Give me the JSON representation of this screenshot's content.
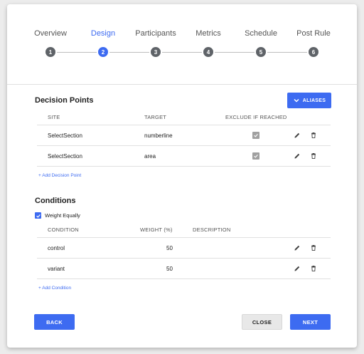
{
  "stepper": {
    "steps": [
      {
        "label": "Overview",
        "number": "1",
        "active": false
      },
      {
        "label": "Design",
        "number": "2",
        "active": true
      },
      {
        "label": "Participants",
        "number": "3",
        "active": false
      },
      {
        "label": "Metrics",
        "number": "4",
        "active": false
      },
      {
        "label": "Schedule",
        "number": "5",
        "active": false
      },
      {
        "label": "Post Rule",
        "number": "6",
        "active": false
      }
    ]
  },
  "decision_points": {
    "title": "Decision Points",
    "aliases_label": "ALIASES",
    "headers": {
      "site": "SITE",
      "target": "TARGET",
      "exclude": "EXCLUDE IF REACHED"
    },
    "rows": [
      {
        "site": "SelectSection",
        "target": "numberline",
        "exclude": true
      },
      {
        "site": "SelectSection",
        "target": "area",
        "exclude": true
      }
    ],
    "add_label": "+ Add Decision Point"
  },
  "conditions": {
    "title": "Conditions",
    "weight_equally_label": "Weight Equally",
    "weight_equally_checked": true,
    "headers": {
      "condition": "CONDITION",
      "weight": "WEIGHT (%)",
      "description": "DESCRIPTION"
    },
    "rows": [
      {
        "condition": "control",
        "weight": "50",
        "description": ""
      },
      {
        "condition": "variant",
        "weight": "50",
        "description": ""
      }
    ],
    "add_label": "+ Add Condition"
  },
  "footer": {
    "back_label": "BACK",
    "close_label": "CLOSE",
    "next_label": "NEXT"
  },
  "colors": {
    "accent": "#3d6bf1",
    "step_inactive": "#5f6368",
    "checkbox_disabled": "#a0a0a0"
  }
}
